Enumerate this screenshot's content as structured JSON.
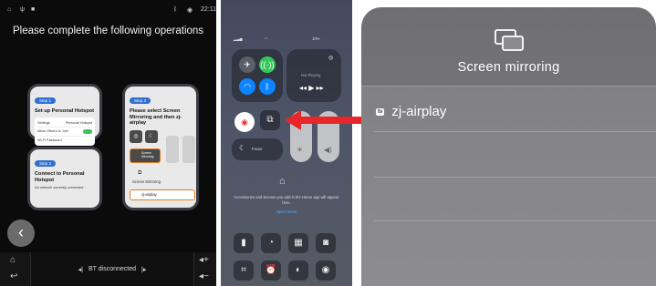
{
  "car": {
    "status_time": "22:11",
    "title": "Please complete the following operations",
    "step1": {
      "badge": "Step 1",
      "title": "Set up Personal Hotspot",
      "rows": [
        "Settings",
        "Personal Hotspot",
        "Allow Others to Join",
        "Wi-Fi Password"
      ]
    },
    "step2": {
      "badge": "Step 2",
      "title": "Connect to Personal Hotspot",
      "desc": "No network currently connected"
    },
    "step3": {
      "badge": "Step 3",
      "title": "Please select Screen Mirroring and then zj-airplay",
      "mirror_tile": "Screen Mirroring",
      "mirror_label": "Screen Mirroring",
      "device": "zj-airplay"
    },
    "bt_status": "BT disconnected"
  },
  "control_center": {
    "battery": "10%",
    "now_playing": "Not Playing",
    "focus": "Focus",
    "home_text": "Accessories and Scenes you add in the Home app will appear here.",
    "home_link": "Open Home"
  },
  "mirroring": {
    "title": "Screen mirroring",
    "device_badge": "tv",
    "device": "zj-airplay"
  },
  "colors": {
    "accent": "#2f6fd0",
    "arrow": "#e8262a",
    "toggle_on": "#3bc35a"
  }
}
